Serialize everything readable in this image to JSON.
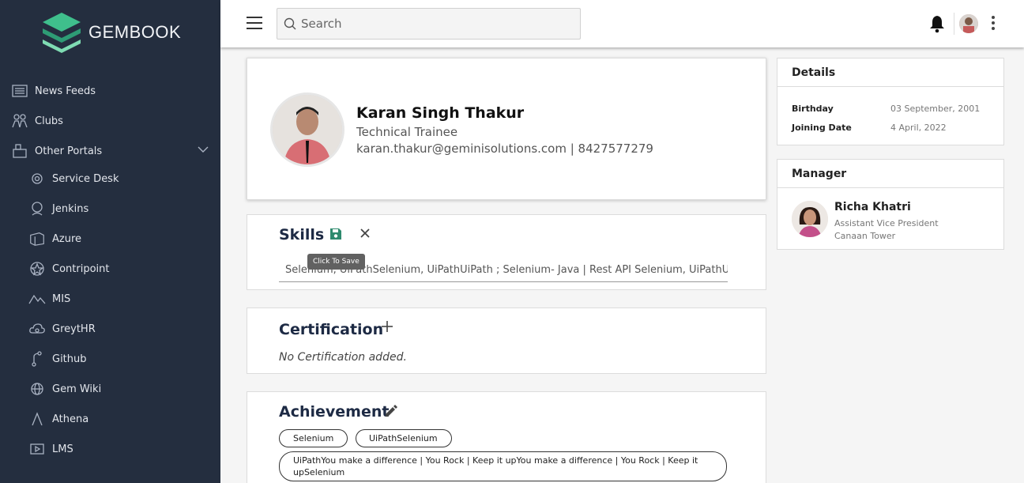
{
  "brand": {
    "name": "GEMBOOK"
  },
  "sidebar": {
    "items": [
      {
        "label": "News Feeds",
        "icon": "news-icon"
      },
      {
        "label": "Clubs",
        "icon": "clubs-icon"
      },
      {
        "label": "Other Portals",
        "icon": "portals-icon"
      },
      {
        "label": "Service Desk",
        "icon": "service-desk-icon"
      },
      {
        "label": "Jenkins",
        "icon": "jenkins-icon"
      },
      {
        "label": "Azure",
        "icon": "azure-icon"
      },
      {
        "label": "Contripoint",
        "icon": "contripoint-icon"
      },
      {
        "label": "MIS",
        "icon": "mis-icon"
      },
      {
        "label": "GreytHR",
        "icon": "greythr-icon"
      },
      {
        "label": "Github",
        "icon": "github-icon"
      },
      {
        "label": "Gem Wiki",
        "icon": "gem-wiki-icon"
      },
      {
        "label": "Athena",
        "icon": "athena-icon"
      },
      {
        "label": "LMS",
        "icon": "lms-icon"
      }
    ]
  },
  "header": {
    "search_placeholder": "Search"
  },
  "profile": {
    "name": "Karan Singh Thakur",
    "role": "Technical Trainee",
    "contact": "karan.thakur@geminisolutions.com | 8427577279"
  },
  "skills": {
    "title": "Skills",
    "value": "Selenium, UiPathSelenium, UiPathUiPath ; Selenium- Java | Rest API Selenium, UiPathUiPath",
    "tooltip": "Click To Save"
  },
  "certification": {
    "title": "Certification",
    "empty_text": "No Certification added."
  },
  "achievement": {
    "title": "Achievement",
    "chips": [
      "Selenium",
      "UiPathSelenium",
      "UiPathYou make a difference | You Rock | Keep it upYou make a difference | You Rock | Keep it upSelenium"
    ]
  },
  "details": {
    "title": "Details",
    "birthday_label": "Birthday",
    "birthday": "03 September, 2001",
    "joining_label": "Joining Date",
    "joining": "4 April, 2022"
  },
  "manager": {
    "title": "Manager",
    "name": "Richa Khatri",
    "designation": "Assistant Vice President",
    "location": "Canaan Tower"
  },
  "colors": {
    "sidebar_bg": "#242e3f",
    "accent_green": "#2e8a6e",
    "title_navy": "#1d2a44"
  }
}
